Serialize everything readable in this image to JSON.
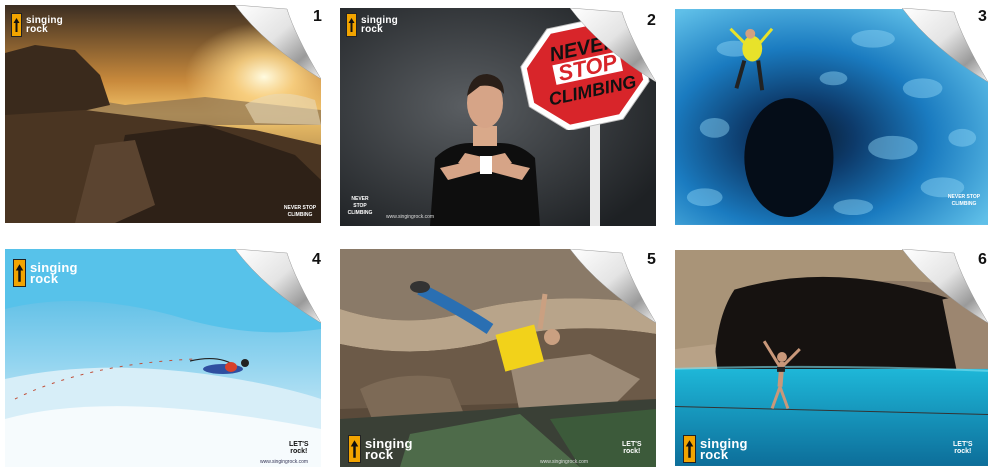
{
  "posters": [
    {
      "number": "1",
      "logo_line1": "singing",
      "logo_line2": "rock",
      "badge": "NEVER STOP CLIMBING"
    },
    {
      "number": "2",
      "logo_line1": "singing",
      "logo_line2": "rock",
      "sign_line1": "NEVER",
      "sign_line2": "STOP",
      "sign_line3": "CLIMBING",
      "badge": "NEVER STOP CLIMBING",
      "url": "www.singingrock.com"
    },
    {
      "number": "3",
      "badge": "NEVER STOP CLIMBING"
    },
    {
      "number": "4",
      "logo_line1": "singing",
      "logo_line2": "rock",
      "badge_line1": "LET'S",
      "badge_line2": "rock!",
      "url": "www.singingrock.com"
    },
    {
      "number": "5",
      "logo_line1": "singing",
      "logo_line2": "rock",
      "badge_line1": "LET'S",
      "badge_line2": "rock!",
      "url": "www.singingrock.com"
    },
    {
      "number": "6",
      "logo_line1": "singing",
      "logo_line2": "rock",
      "badge_line1": "LET'S",
      "badge_line2": "rock!"
    }
  ],
  "colors": {
    "accent": "#f2a400",
    "sign_red": "#d8252a"
  }
}
